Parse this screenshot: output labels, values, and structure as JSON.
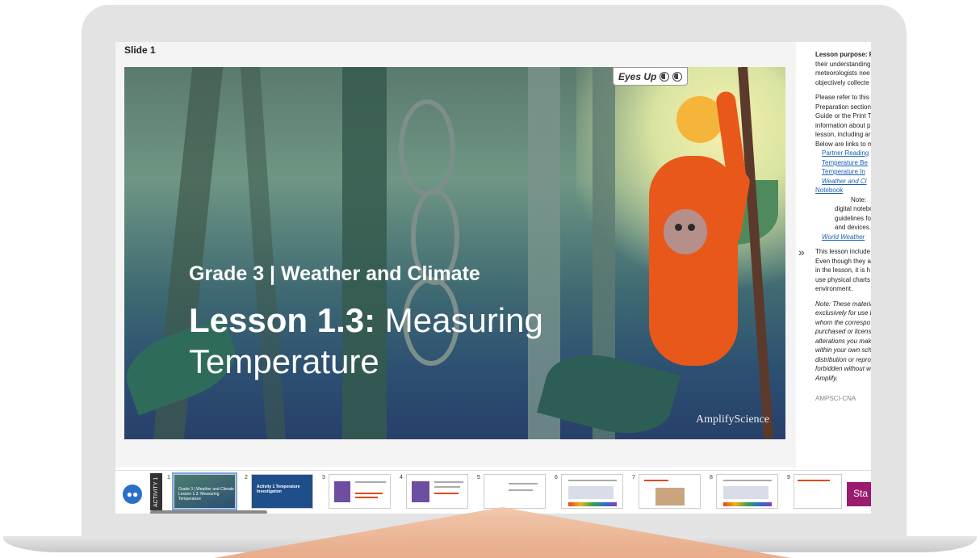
{
  "slide_panel": {
    "label": "Slide 1"
  },
  "slide": {
    "eyes_up_label": "Eyes Up",
    "subtitle": "Grade 3 | Weather and Climate",
    "lesson_bold": "Lesson 1.3:",
    "lesson_rest": " Measuring Temperature",
    "brand": "AmplifyScience"
  },
  "notes": {
    "p1": [
      "Lesson purpose: Fo",
      "their understanding",
      "meteorologists nee",
      "objectively collecte"
    ],
    "p2": [
      "Please refer to this",
      "Preparation section",
      "Guide or the Print T",
      "information about p",
      "lesson, including ar",
      "Below are links to m"
    ],
    "links": [
      "Partner Reading",
      "Temperature Be",
      "Temperature In",
      "Weather and Cl"
    ],
    "notebook_link": "Notebook",
    "note_indent": "Note:",
    "note_lines": [
      "digital notebo",
      "guidelines fo",
      "and devices."
    ],
    "world_link": "World Weather",
    "p3": [
      "This lesson include",
      "Even though they ar",
      "in the lesson, it is h",
      "use physical charts",
      "environment."
    ],
    "p4": [
      "Note: These materia",
      "exclusively for use b",
      "whom the correspo",
      "purchased or licens",
      "alterations you mak",
      "within your own sch",
      "distribution or repro",
      "forbidden without w",
      "Amplify."
    ],
    "footer": "AMPSCI-CNA"
  },
  "filmstrip": {
    "activity_label": "ACTIVITY 1",
    "thumbs": [
      {
        "num": "1",
        "text": "Grade 3 | Weather and Climate Lesson 1.3: Measuring Temperature"
      },
      {
        "num": "2",
        "text": "Activity 1 Temperature Investigation"
      },
      {
        "num": "3",
        "text": ""
      },
      {
        "num": "4",
        "text": ""
      },
      {
        "num": "5",
        "text": ""
      },
      {
        "num": "6",
        "text": ""
      },
      {
        "num": "7",
        "text": ""
      },
      {
        "num": "8",
        "text": ""
      },
      {
        "num": "9",
        "text": ""
      }
    ],
    "start_label": "Sta"
  },
  "colors": {
    "accent": "#9b1b6e",
    "link": "#1a5fb4",
    "people_button": "#2a6fc9"
  }
}
